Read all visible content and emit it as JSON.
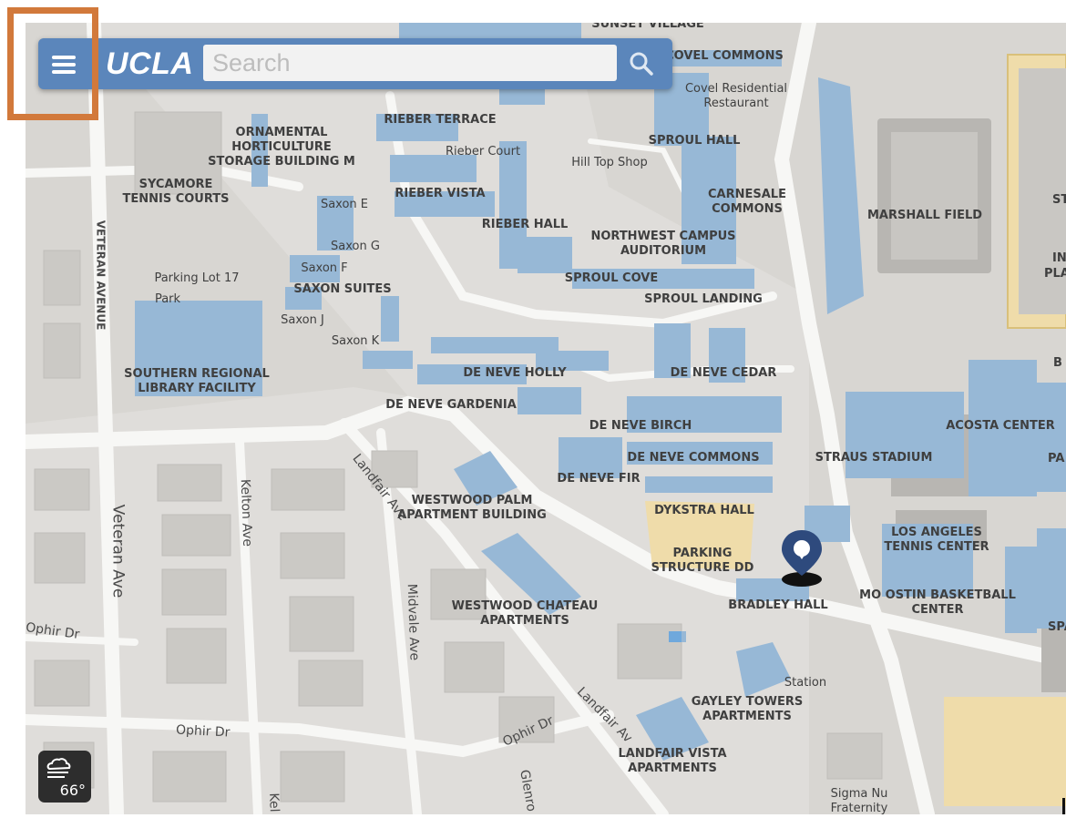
{
  "brand": "UCLA",
  "search": {
    "placeholder": "Search"
  },
  "weather": {
    "temperature": "66°"
  },
  "colors": {
    "topbar": "#5b86bb",
    "building": "#97b8d6",
    "parking": "#efdcaa",
    "highlight": "#d2793b",
    "pin": "#2e4a7d"
  },
  "icons": [
    "menu-icon",
    "search-icon",
    "weather-cloud-icon",
    "location-pin-icon"
  ],
  "buildings": [
    {
      "id": "sunset-village",
      "lines": [
        "SUNSET VILLAGE"
      ],
      "bold": true
    },
    {
      "id": "covel-commons",
      "lines": [
        "COVEL COMMONS"
      ],
      "bold": true
    },
    {
      "id": "covel-restaurant",
      "lines": [
        "Covel Residential",
        "Restaurant"
      ],
      "bold": false
    },
    {
      "id": "ornamental",
      "lines": [
        "ORNAMENTAL",
        "HORTICULTURE",
        "STORAGE BUILDING M"
      ],
      "bold": true
    },
    {
      "id": "rieber-terrace",
      "lines": [
        "RIEBER TERRACE"
      ],
      "bold": true
    },
    {
      "id": "rieber-court",
      "lines": [
        "Rieber Court"
      ],
      "bold": false
    },
    {
      "id": "sproul-hall",
      "lines": [
        "SPROUL HALL"
      ],
      "bold": true
    },
    {
      "id": "hill-top-shop",
      "lines": [
        "Hill Top Shop"
      ],
      "bold": false
    },
    {
      "id": "sycamore",
      "lines": [
        "SYCAMORE",
        "TENNIS COURTS"
      ],
      "bold": true
    },
    {
      "id": "rieber-vista",
      "lines": [
        "RIEBER VISTA"
      ],
      "bold": true
    },
    {
      "id": "carnesale",
      "lines": [
        "CARNESALE",
        "COMMONS"
      ],
      "bold": true
    },
    {
      "id": "marshall-field",
      "lines": [
        "MARSHALL FIELD"
      ],
      "bold": true
    },
    {
      "id": "saxon-e",
      "lines": [
        "Saxon E"
      ],
      "bold": false
    },
    {
      "id": "rieber-hall",
      "lines": [
        "RIEBER HALL"
      ],
      "bold": true
    },
    {
      "id": "nw-auditorium",
      "lines": [
        "NORTHWEST CAMPUS",
        "AUDITORIUM"
      ],
      "bold": true
    },
    {
      "id": "saxon-g",
      "lines": [
        "Saxon G"
      ],
      "bold": false
    },
    {
      "id": "saxon-f",
      "lines": [
        "Saxon F"
      ],
      "bold": false
    },
    {
      "id": "parking-lot-17",
      "lines": [
        "Parking Lot 17"
      ],
      "bold": false
    },
    {
      "id": "sproul-cove",
      "lines": [
        "SPROUL COVE"
      ],
      "bold": true
    },
    {
      "id": "saxon-suites",
      "lines": [
        "SAXON SUITES"
      ],
      "bold": true
    },
    {
      "id": "park",
      "lines": [
        "Park"
      ],
      "bold": false
    },
    {
      "id": "sproul-landing",
      "lines": [
        "SPROUL LANDING"
      ],
      "bold": true
    },
    {
      "id": "saxon-j",
      "lines": [
        "Saxon J"
      ],
      "bold": false
    },
    {
      "id": "saxon-k",
      "lines": [
        "Saxon K"
      ],
      "bold": false
    },
    {
      "id": "srlf",
      "lines": [
        "SOUTHERN REGIONAL",
        "LIBRARY FACILITY"
      ],
      "bold": true
    },
    {
      "id": "de-neve-holly",
      "lines": [
        "DE NEVE HOLLY"
      ],
      "bold": true
    },
    {
      "id": "de-neve-cedar",
      "lines": [
        "DE NEVE CEDAR"
      ],
      "bold": true
    },
    {
      "id": "de-neve-gardenia",
      "lines": [
        "DE NEVE GARDENIA"
      ],
      "bold": true
    },
    {
      "id": "de-neve-birch",
      "lines": [
        "DE NEVE BIRCH"
      ],
      "bold": true
    },
    {
      "id": "acosta-center",
      "lines": [
        "ACOSTA CENTER"
      ],
      "bold": true
    },
    {
      "id": "de-neve-commons",
      "lines": [
        "DE NEVE COMMONS"
      ],
      "bold": true
    },
    {
      "id": "straus-stadium",
      "lines": [
        "STRAUS STADIUM"
      ],
      "bold": true
    },
    {
      "id": "de-neve-fir",
      "lines": [
        "DE NEVE FIR"
      ],
      "bold": true
    },
    {
      "id": "westwood-palm",
      "lines": [
        "WESTWOOD PALM",
        "APARTMENT BUILDING"
      ],
      "bold": true
    },
    {
      "id": "dykstra-hall",
      "lines": [
        "DYKSTRA HALL"
      ],
      "bold": true
    },
    {
      "id": "la-tennis",
      "lines": [
        "LOS ANGELES",
        "TENNIS CENTER"
      ],
      "bold": true
    },
    {
      "id": "parking-dd",
      "lines": [
        "PARKING",
        "STRUCTURE DD"
      ],
      "bold": true
    },
    {
      "id": "mo-ostin",
      "lines": [
        "MO OSTIN BASKETBALL",
        "CENTER"
      ],
      "bold": true
    },
    {
      "id": "westwood-chateau",
      "lines": [
        "WESTWOOD CHATEAU",
        "APARTMENTS"
      ],
      "bold": true
    },
    {
      "id": "bradley-hall",
      "lines": [
        "BRADLEY HALL"
      ],
      "bold": true
    },
    {
      "id": "gayley-towers",
      "lines": [
        "GAYLEY TOWERS",
        "APARTMENTS"
      ],
      "bold": true
    },
    {
      "id": "landfair-vista",
      "lines": [
        "LANDFAIR VISTA",
        "APARTMENTS"
      ],
      "bold": true
    },
    {
      "id": "sigma-nu",
      "lines": [
        "Sigma Nu",
        "Fraternity"
      ],
      "bold": false
    },
    {
      "id": "station",
      "lines": [
        "Station"
      ],
      "bold": false
    }
  ],
  "edge_fragments": [
    "ST",
    "IN",
    "PLA",
    "B",
    "PA",
    "SPA"
  ],
  "streets": [
    "VETERAN AVENUE",
    "Veteran Ave",
    "Kelton Ave",
    "Landfair Ave",
    "Midvale Ave",
    "Ophir Dr",
    "Ophir Dr",
    "Ophir Dr",
    "Landfair Av",
    "Glenro",
    "Kel"
  ]
}
